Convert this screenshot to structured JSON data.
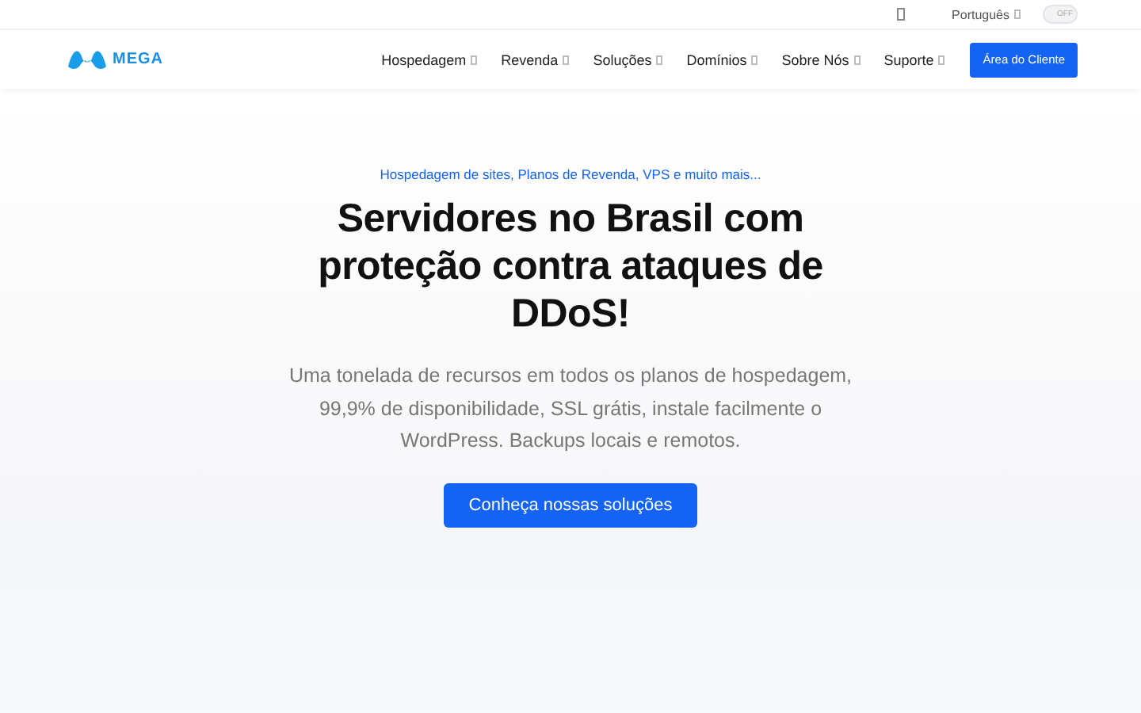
{
  "topbar": {
    "language": "Português",
    "dark_mode": {
      "label": "OFF",
      "on": false
    }
  },
  "header": {
    "logo": "MEGA",
    "nav": [
      {
        "label": "Hospedagem"
      },
      {
        "label": "Revenda"
      },
      {
        "label": "Soluções"
      },
      {
        "label": "Domínios"
      },
      {
        "label": "Sobre Nós"
      },
      {
        "label": "Suporte"
      }
    ],
    "client_button": "Área do Cliente"
  },
  "hero": {
    "eyebrow": "Hospedagem de sites, Planos de Revenda, VPS e muito mais...",
    "title": "Servidores no Brasil com proteção contra ataques de DDoS!",
    "description": "Uma tonelada de recursos em todos os planos de hospedagem, 99,9% de disponibilidade, SSL grátis, instale facilmente o WordPress. Backups locais e remotos.",
    "cta": "Conheça nossas soluções"
  }
}
